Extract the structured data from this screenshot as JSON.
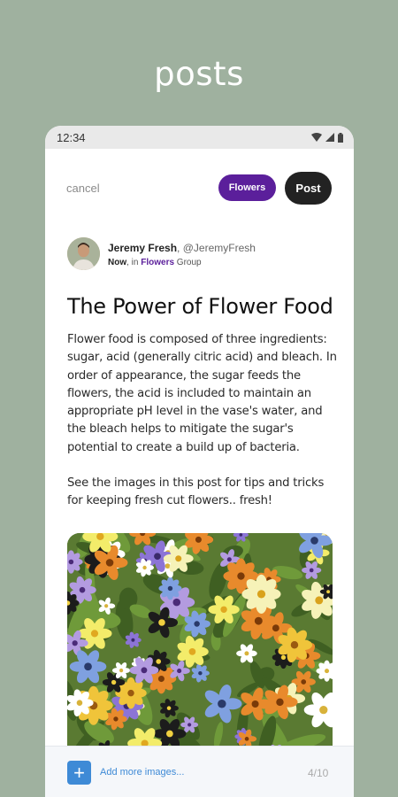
{
  "hero": {
    "title": "posts"
  },
  "status": {
    "time": "12:34",
    "icons": [
      "wifi-icon",
      "signal-icon",
      "battery-icon"
    ]
  },
  "toolbar": {
    "cancel_label": "cancel",
    "chip_label": "Flowers",
    "post_label": "Post"
  },
  "author": {
    "name": "Jeremy Fresh",
    "handle": ", @JeremyFresh",
    "time": "Now",
    "in_text": ", in ",
    "group": "Flowers",
    "group_suffix": " Group"
  },
  "post": {
    "title": "The Power of Flower Food",
    "paragraph1": "Flower food is composed of three ingredients: sugar, acid (generally citric acid) and bleach. In order of appearance, the sugar feeds the flowers, the acid is included to maintain an appropriate pH level in the vase's water, and the bleach helps to mitigate the sugar's potential to create a build up of bacteria.",
    "paragraph2": "See the images in this post for tips and tricks for keeping fresh cut flowers.. fresh!"
  },
  "bottom": {
    "add_label": "Add more images...",
    "count": "4/10"
  },
  "colors": {
    "background": "#9fb19f",
    "accent_purple": "#5b1f9b",
    "post_button": "#222222",
    "link_blue": "#3e8ad6"
  }
}
